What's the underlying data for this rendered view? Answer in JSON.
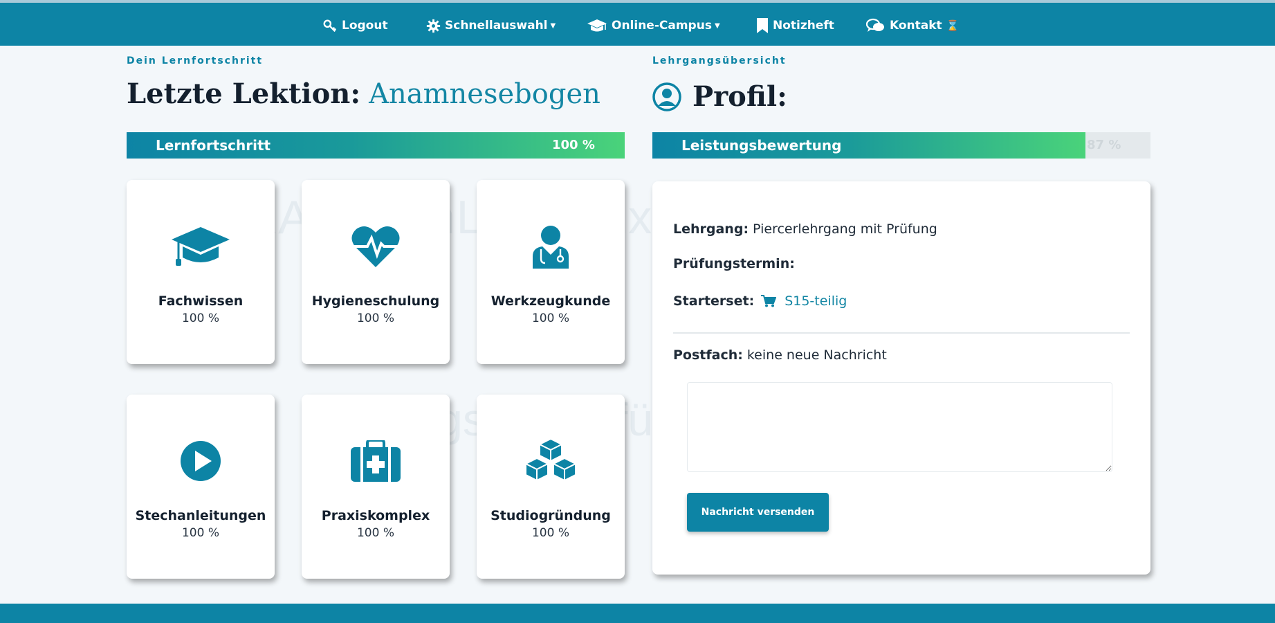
{
  "nav": [
    {
      "label": "Logout",
      "icon": "key-icon"
    },
    {
      "label": "Schnellauswahl",
      "icon": "gear-icon",
      "dropdown": true
    },
    {
      "label": "Online-Campus",
      "icon": "graduation-cap-icon",
      "dropdown": true
    },
    {
      "label": "Notizheft",
      "icon": "bookmark-icon"
    },
    {
      "label": "Kontakt",
      "icon": "chat-icon",
      "badge": "⌛"
    }
  ],
  "watermark": {
    "line1": "aXA6MTcnLjUxLjExLjE5OCZpZDo2Mg==",
    "line2": "Zugangslizenz für: Gmail Test"
  },
  "progress_section": {
    "kicker": "Dein Lernfortschritt",
    "heading_prefix": "Letzte Lektion:",
    "heading_lesson": "Anamnesebogen",
    "bar_label": "Lernfortschritt",
    "bar_value_text": "100 %",
    "bar_fraction": 1.0
  },
  "modules": [
    {
      "title": "Fachwissen",
      "percent": "100 %",
      "icon": "graduation-cap-icon"
    },
    {
      "title": "Hygieneschulung",
      "percent": "100 %",
      "icon": "heart-pulse-icon"
    },
    {
      "title": "Werkzeugkunde",
      "percent": "100 %",
      "icon": "doctor-icon"
    },
    {
      "title": "Stechanleitungen",
      "percent": "100 %",
      "icon": "play-circle-icon"
    },
    {
      "title": "Praxiskomplex",
      "percent": "100 %",
      "icon": "medkit-icon"
    },
    {
      "title": "Studiogründung",
      "percent": "100 %",
      "icon": "cubes-icon"
    }
  ],
  "profile_section": {
    "kicker": "Lehrgangsübersicht",
    "heading": "Profil:",
    "bar_label": "Leistungsbewertung",
    "bar_value_text": "87 %",
    "bar_fraction": 0.87,
    "lehrgang_label": "Lehrgang:",
    "lehrgang_value": "Piercerlehrgang mit Prüfung",
    "pruefung_label": "Prüfungstermin:",
    "pruefung_value": "",
    "starterset_label": "Starterset:",
    "starterset_link": "S15-teilig",
    "postfach_label": "Postfach:",
    "postfach_value": "keine neue Nachricht",
    "message_placeholder": "",
    "send_button": "Nachricht versenden"
  },
  "colors": {
    "primary": "#0d84a5",
    "accent": "#1386a4",
    "success": "#4ad37a",
    "background": "#f3f7fa"
  }
}
